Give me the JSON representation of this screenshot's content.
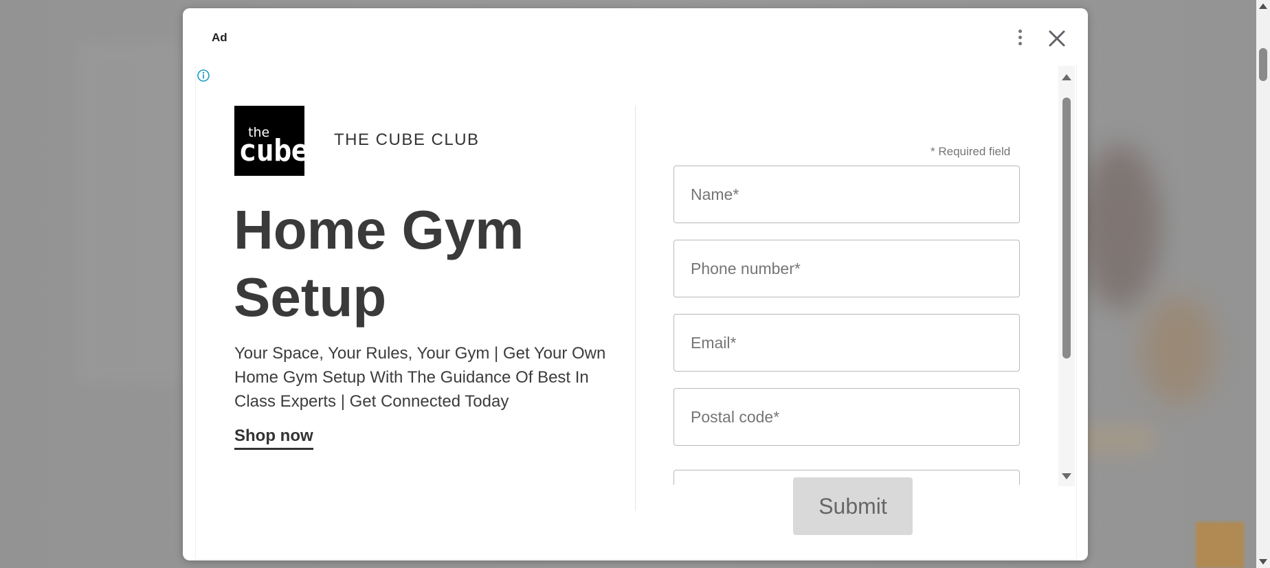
{
  "dialog": {
    "ad_label": "Ad",
    "menu_icon": "more-vert-icon",
    "close_icon": "close-icon",
    "info_icon": "info-icon"
  },
  "advertiser": {
    "logo_text_small": "the",
    "logo_text_large": "cube",
    "name": "THE CUBE CLUB"
  },
  "ad": {
    "headline": "Home Gym Setup",
    "description": "Your Space, Your Rules, Your Gym | Get Your Own Home Gym Setup With The Guidance Of Best In Class Experts | Get Connected Today",
    "cta": "Shop now"
  },
  "form": {
    "required_note": "* Required field",
    "fields": [
      {
        "placeholder": "Name*"
      },
      {
        "placeholder": "Phone number*"
      },
      {
        "placeholder": "Email*"
      },
      {
        "placeholder": "Postal code*"
      }
    ],
    "submit_label": "Submit"
  },
  "colors": {
    "overlay": "#8e8e8e",
    "info_icon": "#1a9bc4",
    "submit_bg": "#d9d9d9"
  }
}
